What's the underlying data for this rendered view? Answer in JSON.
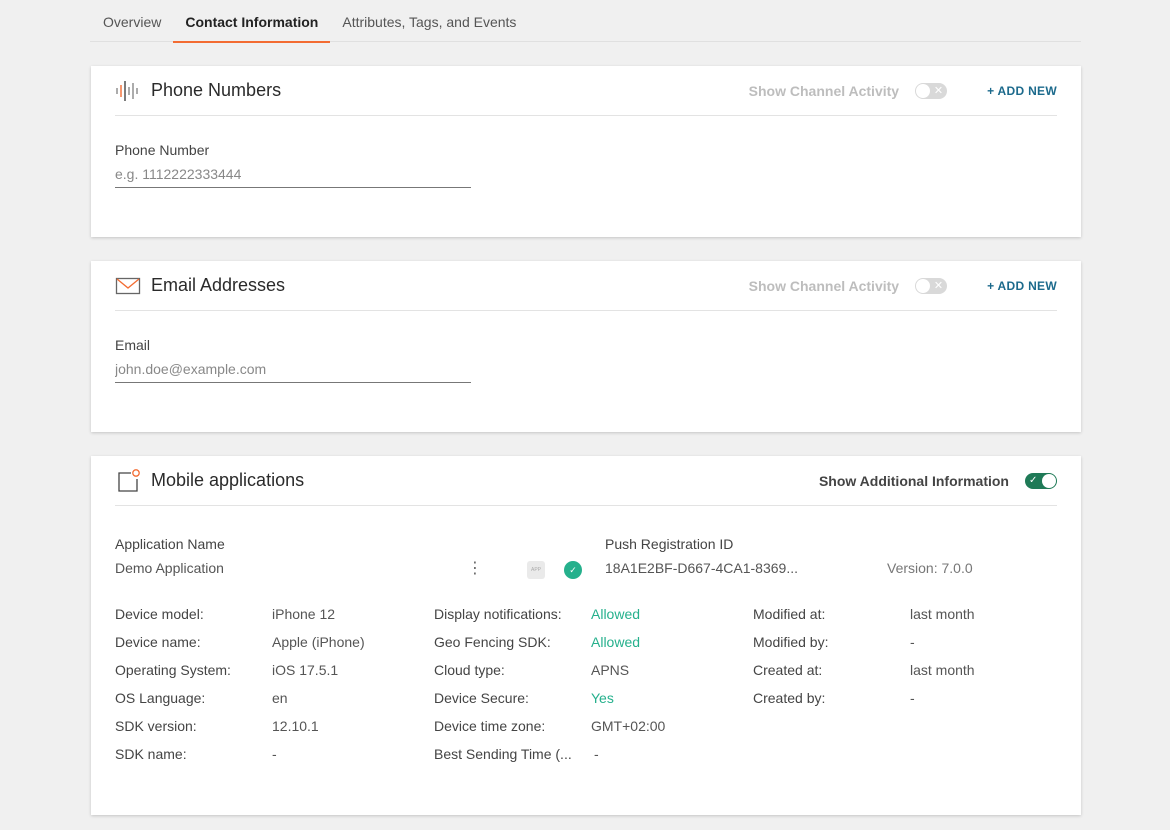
{
  "tabs": [
    {
      "label": "Overview",
      "active": false
    },
    {
      "label": "Contact Information",
      "active": true
    },
    {
      "label": "Attributes, Tags, and Events",
      "active": false
    }
  ],
  "phone": {
    "title": "Phone Numbers",
    "icon": "phone-waveform-icon",
    "show_activity_label": "Show Channel Activity",
    "show_activity_on": false,
    "add_new_label": "+ ADD NEW",
    "field_label": "Phone Number",
    "field_value": "",
    "field_placeholder": "e.g. 1112222333444"
  },
  "email": {
    "title": "Email Addresses",
    "icon": "envelope-icon",
    "show_activity_label": "Show Channel Activity",
    "show_activity_on": false,
    "add_new_label": "+ ADD NEW",
    "field_label": "Email",
    "field_value": "",
    "field_placeholder": "john.doe@example.com"
  },
  "mobile": {
    "title": "Mobile applications",
    "icon": "mobile-app-icon",
    "show_additional_label": "Show Additional Information",
    "show_additional_on": true,
    "app_name_label": "Application Name",
    "app_name": "Demo Application",
    "app_badge": "APP",
    "push_id_label": "Push Registration ID",
    "push_id": "18A1E2BF-D667-4CA1-8369...",
    "version": "Version: 7.0.0",
    "colors": {
      "allowed": "#25b08c",
      "toggle_on": "#1f7a57",
      "accent": "#f36c32",
      "link": "#1c6a8c"
    },
    "columns": [
      [
        {
          "key": "Device model:",
          "value": "iPhone 12"
        },
        {
          "key": "Device name:",
          "value": "Apple (iPhone)"
        },
        {
          "key": "Operating System:",
          "value": "iOS 17.5.1"
        },
        {
          "key": "OS Language:",
          "value": "en"
        },
        {
          "key": "SDK version:",
          "value": "12.10.1"
        },
        {
          "key": "SDK name:",
          "value": "-"
        }
      ],
      [
        {
          "key": "Display notifications:",
          "value": "Allowed",
          "status": "green"
        },
        {
          "key": "Geo Fencing SDK:",
          "value": "Allowed",
          "status": "green"
        },
        {
          "key": "Cloud type:",
          "value": "APNS"
        },
        {
          "key": "Device Secure:",
          "value": "Yes",
          "status": "green"
        },
        {
          "key": "Device time zone:",
          "value": "GMT+02:00"
        },
        {
          "key": "Best Sending Time (...",
          "value": "-"
        }
      ],
      [
        {
          "key": "Modified at:",
          "value": "last month"
        },
        {
          "key": "Modified by:",
          "value": "-"
        },
        {
          "key": "Created at:",
          "value": "last month"
        },
        {
          "key": "Created by:",
          "value": "-"
        }
      ]
    ]
  }
}
